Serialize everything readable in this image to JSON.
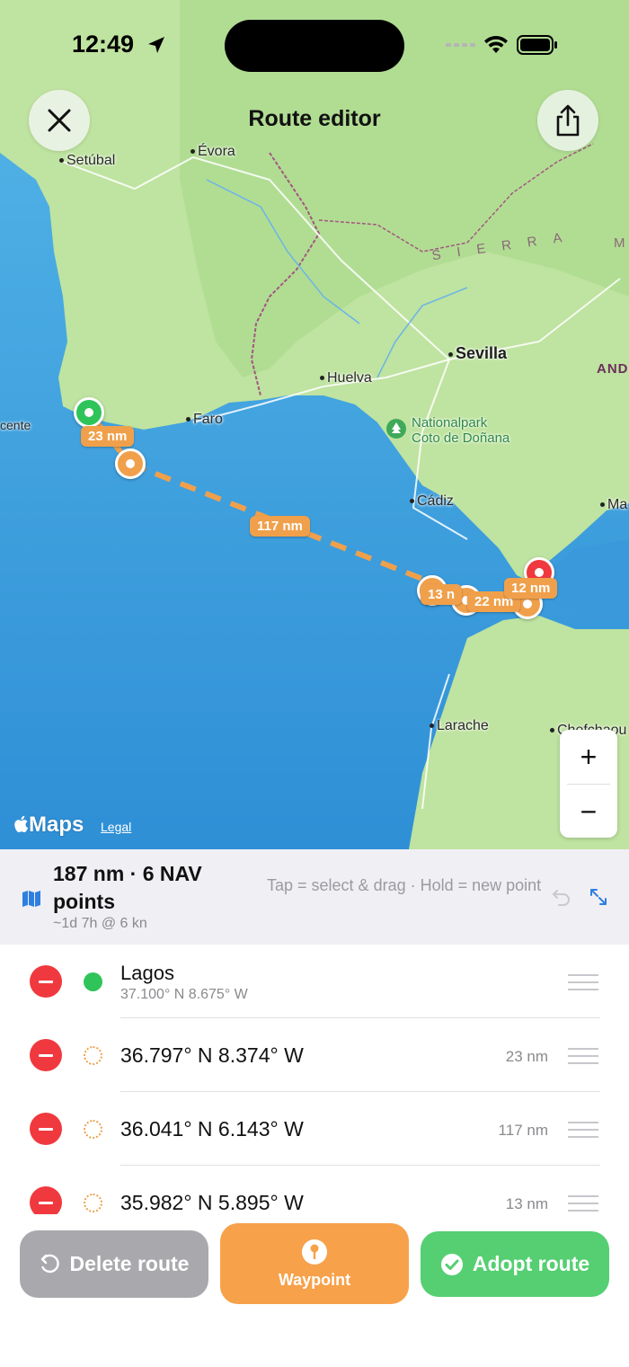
{
  "status": {
    "time": "12:49"
  },
  "header": {
    "title": "Route editor",
    "close_icon": "close-icon",
    "share_icon": "share-icon"
  },
  "map": {
    "places": {
      "setubal": "Setúbal",
      "evora": "Évora",
      "sierra": "SIERRA",
      "sierra_m": "M",
      "sevilla": "Sevilla",
      "and": "AND",
      "huelva": "Huelva",
      "faro": "Faro",
      "vicente": "cente",
      "park_line1": "Nationalpark",
      "park_line2": "Coto de Doñana",
      "cadiz": "Cádiz",
      "ma": "Ma",
      "larache": "Larache",
      "chefchaouen": "Chefchaou"
    },
    "leg_labels": [
      "23 nm",
      "117 nm",
      "13 n",
      "22 nm",
      "12 nm"
    ],
    "attribution": {
      "logo": "Maps",
      "legal": "Legal"
    },
    "zoom": {
      "in": "+",
      "out": "−"
    },
    "colors": {
      "route": "#f0a04b",
      "start": "#2fc45a",
      "end": "#f0393e"
    }
  },
  "summary": {
    "title": "187 nm · 6 NAV points",
    "subtitle": "~1d 7h @ 6 kn",
    "hint": "Tap = select & drag · Hold = new point"
  },
  "waypoints": [
    {
      "name": "Lagos",
      "coords": "37.100° N  8.675° W",
      "distance": "",
      "type": "start"
    },
    {
      "name": "",
      "coords": "36.797° N  8.374° W",
      "distance": "23 nm",
      "type": "waypoint"
    },
    {
      "name": "",
      "coords": "36.041° N  6.143° W",
      "distance": "117 nm",
      "type": "waypoint"
    },
    {
      "name": "",
      "coords": "35.982° N  5.895° W",
      "distance": "13 nm",
      "type": "waypoint"
    }
  ],
  "actions": {
    "delete_route": "Delete route",
    "waypoint": "Waypoint",
    "adopt_route": "Adopt route"
  }
}
